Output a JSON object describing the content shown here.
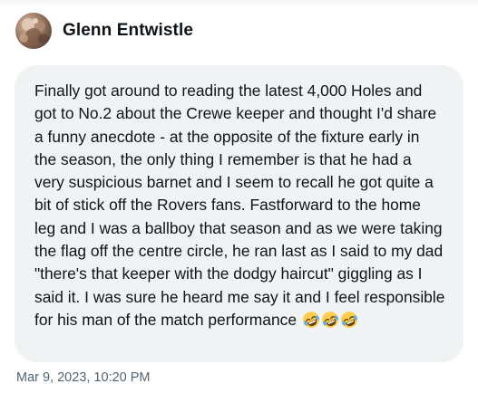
{
  "dm": {
    "sender": {
      "name": "Glenn Entwistle",
      "avatar_icon": "user-avatar-photo"
    },
    "message": {
      "text": "Finally got around to reading the latest 4,000 Holes and got to No.2 about the Crewe keeper and thought I'd share a funny anecdote - at the opposite of the fixture early in the season, the only thing I remember is that he had a very suspicious barnet and I seem to recall he got quite a bit of stick off the Rovers fans. Fastforward to the home leg and I was a ballboy that season and as we were taking the flag off the centre circle, he ran last as I said to my dad \"there's that keeper with the dodgy haircut\" giggling as I said it. I was sure he heard me say it and I feel responsible for his man of the match performance",
      "emojis": [
        "rolling-on-floor-laughing",
        "rolling-on-floor-laughing",
        "rolling-on-floor-laughing"
      ],
      "bubble_color": "#eff3f4"
    },
    "timestamp": "Mar 9, 2023, 10:20 PM"
  }
}
